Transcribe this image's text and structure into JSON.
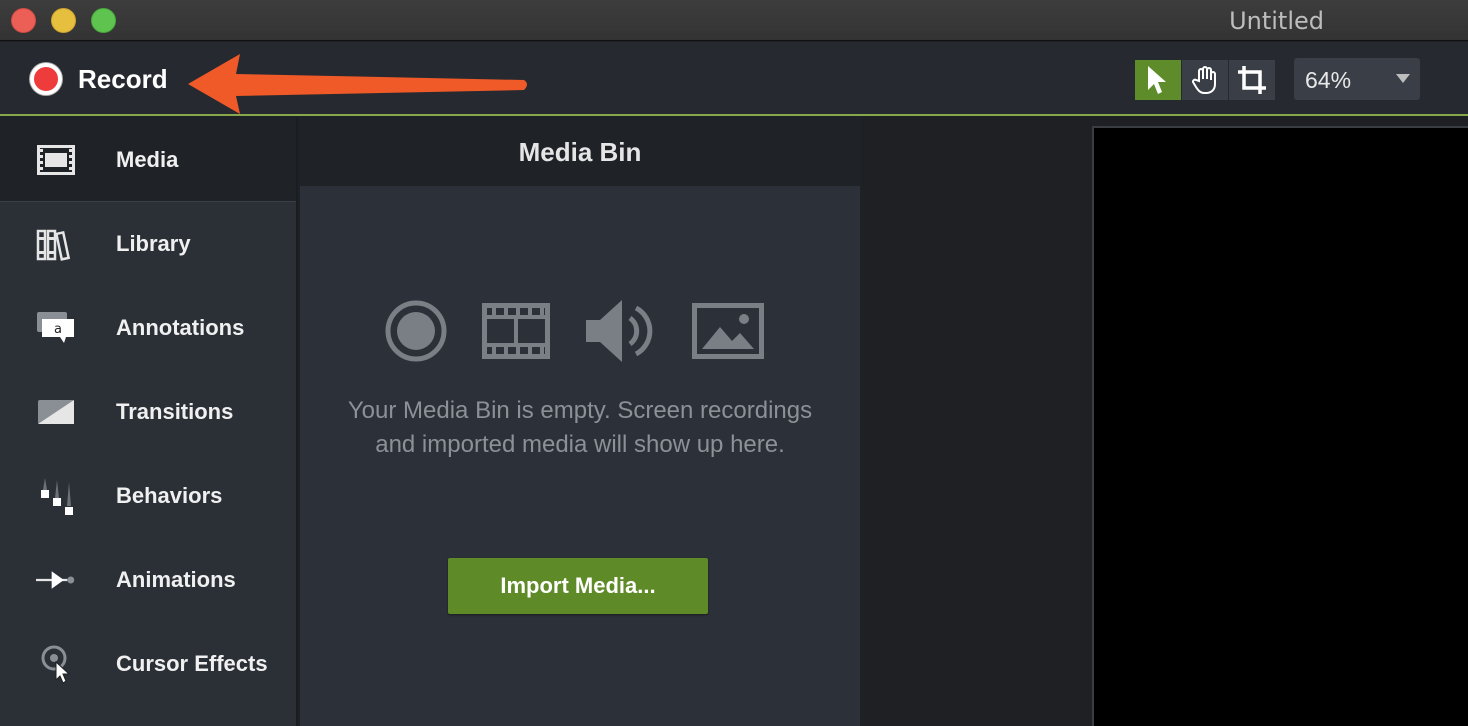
{
  "window": {
    "title": "Untitled"
  },
  "toolbar": {
    "record_label": "Record",
    "zoom": {
      "selected": "64%"
    },
    "tools": [
      "select",
      "pan",
      "crop"
    ]
  },
  "sidebar": {
    "items": [
      {
        "label": "Media",
        "icon": "film-icon",
        "active": true
      },
      {
        "label": "Library",
        "icon": "library-icon",
        "active": false
      },
      {
        "label": "Annotations",
        "icon": "annotation-icon",
        "active": false
      },
      {
        "label": "Transitions",
        "icon": "transition-icon",
        "active": false
      },
      {
        "label": "Behaviors",
        "icon": "behaviors-icon",
        "active": false
      },
      {
        "label": "Animations",
        "icon": "animation-icon",
        "active": false
      },
      {
        "label": "Cursor Effects",
        "icon": "cursor-effects-icon",
        "active": false
      }
    ]
  },
  "media_bin": {
    "title": "Media Bin",
    "empty_message": "Your Media Bin is empty. Screen recordings and imported media will show up here.",
    "import_label": "Import Media..."
  },
  "colors": {
    "accent_green": "#5e8a28",
    "record_red": "#ee3b3b",
    "annotation_arrow": "#f05a28"
  }
}
